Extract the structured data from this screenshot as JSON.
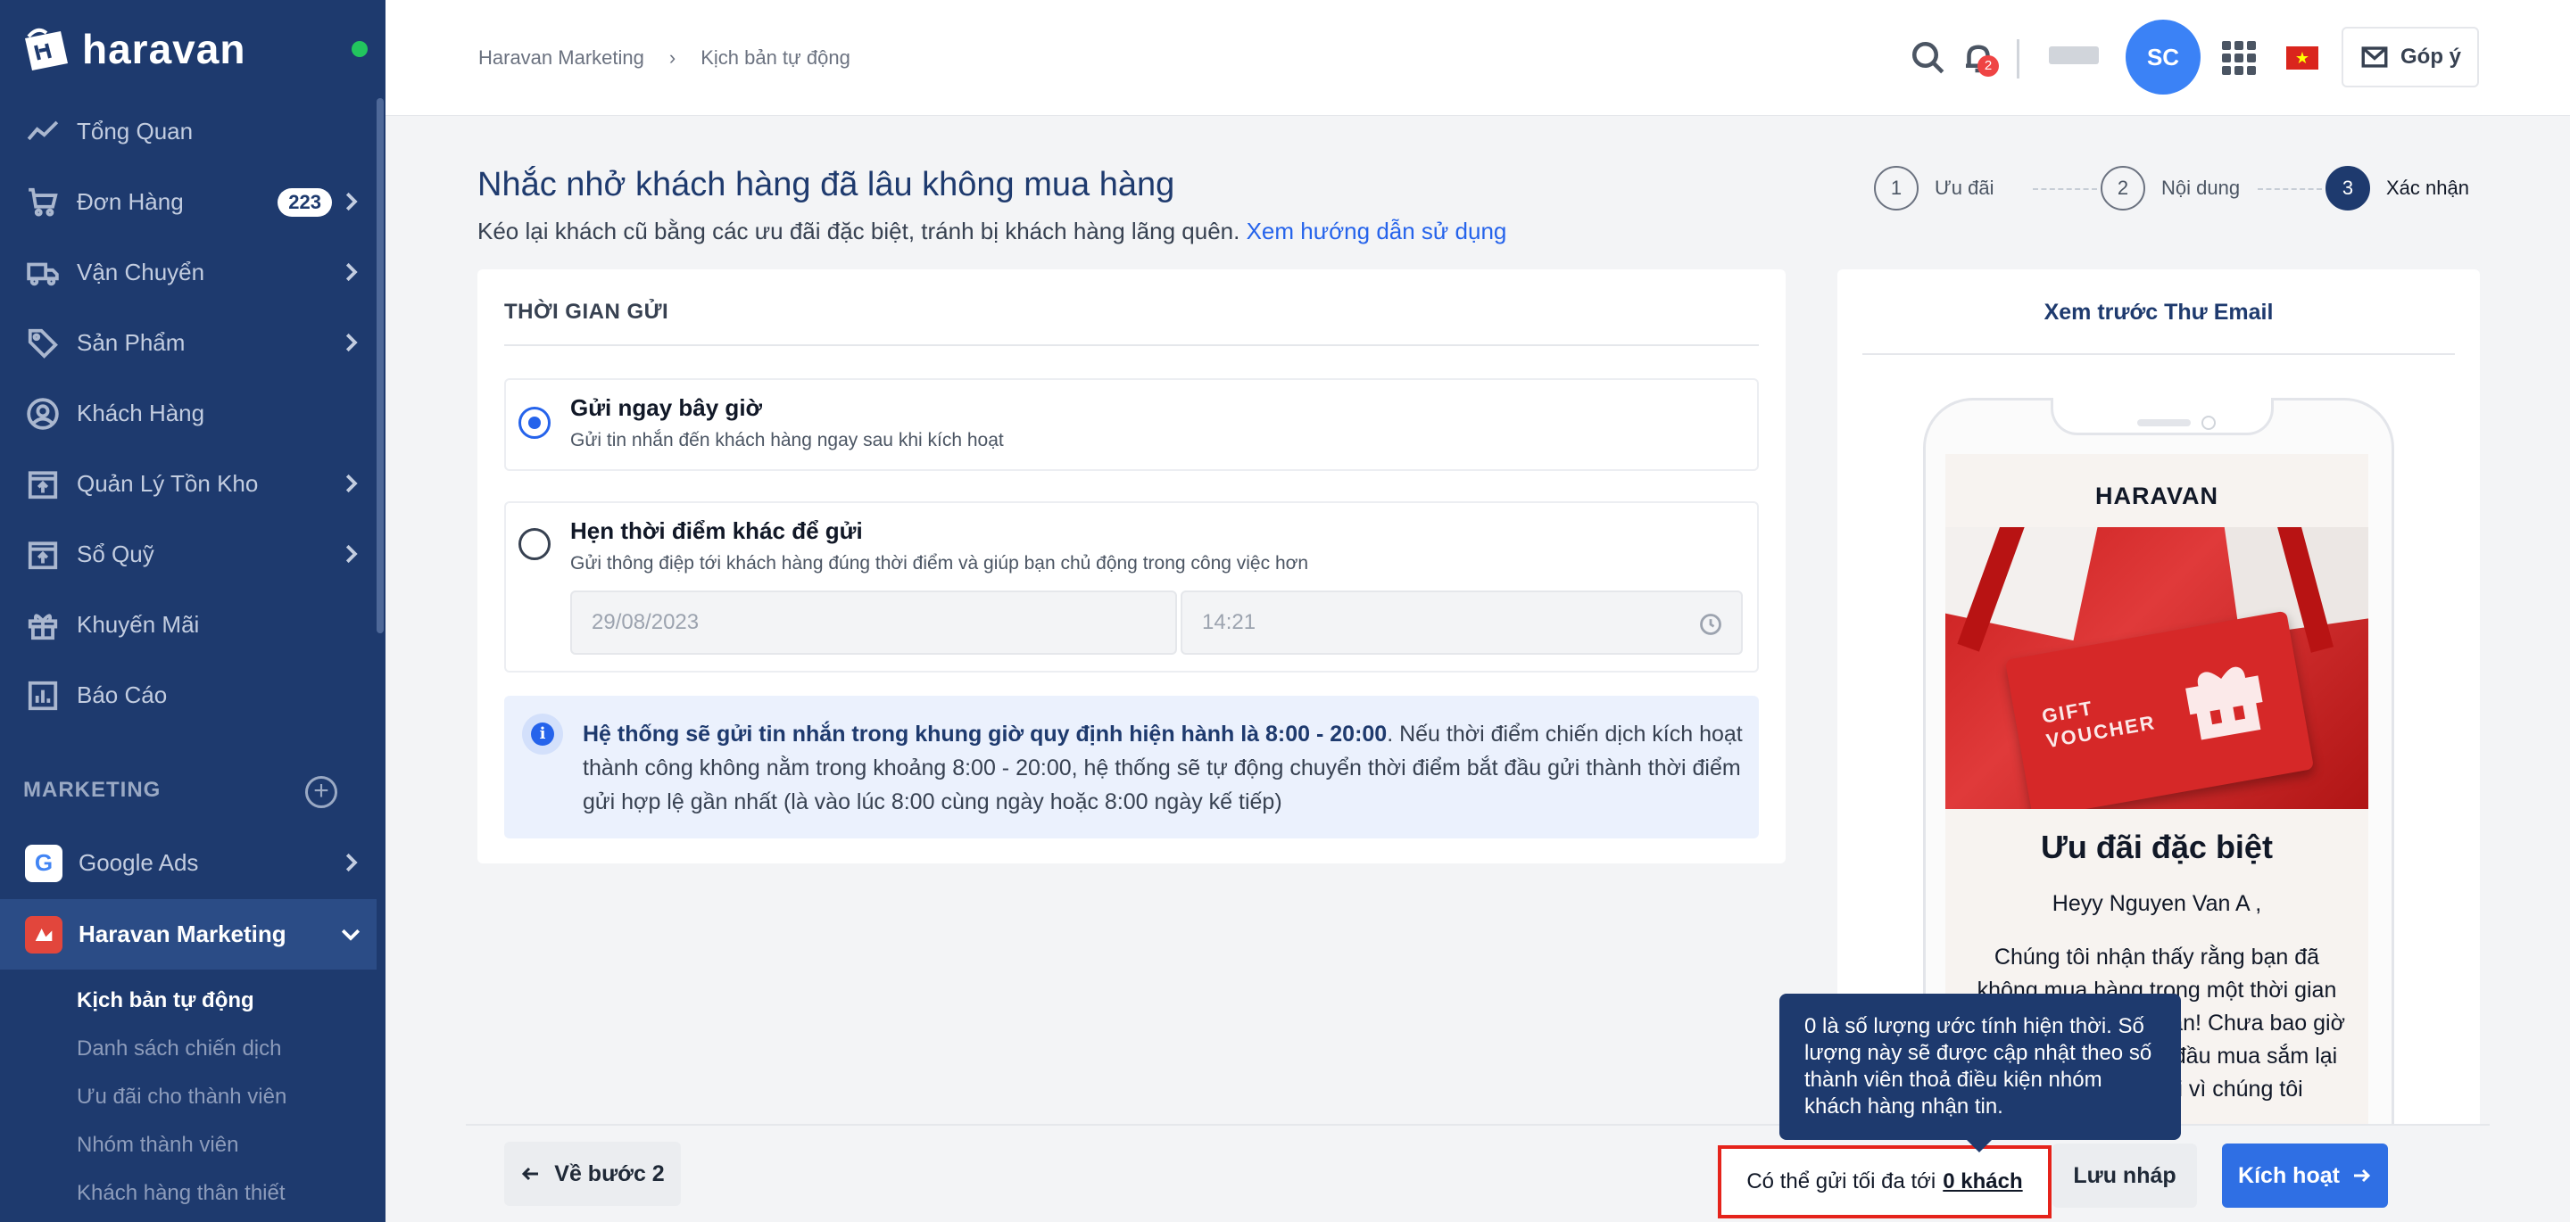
{
  "app": {
    "logo_text": "haravan"
  },
  "sidebar": {
    "items": [
      {
        "label": "Tổng Quan",
        "icon": "trend-icon"
      },
      {
        "label": "Đơn Hàng",
        "icon": "cart-icon",
        "badge": "223"
      },
      {
        "label": "Vận Chuyển",
        "icon": "truck-icon"
      },
      {
        "label": "Sản Phẩm",
        "icon": "tag-icon"
      },
      {
        "label": "Khách Hàng",
        "icon": "user-icon"
      },
      {
        "label": "Quản Lý Tồn Kho",
        "icon": "inventory-icon"
      },
      {
        "label": "Sổ Quỹ",
        "icon": "cashbook-icon"
      },
      {
        "label": "Khuyến Mãi",
        "icon": "gift-icon"
      },
      {
        "label": "Báo Cáo",
        "icon": "report-icon"
      }
    ],
    "section_label": "MARKETING",
    "apps": [
      {
        "label": "Google Ads",
        "icon": "google-icon"
      },
      {
        "label": "Haravan Marketing",
        "icon": "haravan-marketing-icon"
      }
    ],
    "sub_items": [
      "Kịch bản tự động",
      "Danh sách chiến dịch",
      "Ưu đãi cho thành viên",
      "Nhóm thành viên",
      "Khách hàng thân thiết"
    ]
  },
  "topbar": {
    "breadcrumb": [
      "Haravan Marketing",
      "›",
      "Kịch bản tự động"
    ],
    "notification_count": "2",
    "avatar_initials": "SC",
    "feedback_label": "Góp ý",
    "flag_star": "★"
  },
  "page": {
    "title": "Nhắc nhở khách hàng đã lâu không mua hàng",
    "subtitle": "Kéo lại khách cũ bằng các ưu đãi đặc biệt, tránh bị khách hàng lãng quên.",
    "help_link": "Xem hướng dẫn sử dụng",
    "steps": [
      {
        "num": "1",
        "label": "Ưu đãi"
      },
      {
        "num": "2",
        "label": "Nội dung"
      },
      {
        "num": "3",
        "label": "Xác nhận"
      }
    ]
  },
  "send_time": {
    "section_title": "THỜI GIAN GỬI",
    "option_now_title": "Gửi ngay bây giờ",
    "option_now_desc": "Gửi tin nhắn đến khách hàng ngay sau khi kích hoạt",
    "option_schedule_title": "Hẹn thời điểm khác để gửi",
    "option_schedule_desc": "Gửi thông điệp tới khách hàng đúng thời điểm và giúp bạn chủ động trong công việc hơn",
    "date_value": "29/08/2023",
    "time_value": "14:21",
    "info_bold": "Hệ thống sẽ gửi tin nhắn trong khung giờ quy định hiện hành là 8:00 - 20:00",
    "info_rest": ". Nếu thời điểm chiến dịch kích hoạt thành công không nằm trong khoảng 8:00 - 20:00, hệ thống sẽ tự động chuyển thời điểm bắt đầu gửi thành thời điểm gửi hợp lệ gần nhất (là vào lúc 8:00 cùng ngày hoặc 8:00 ngày kế tiếp)",
    "info_icon_char": "i"
  },
  "preview": {
    "title": "Xem trước Thư Email",
    "brand": "HARAVAN",
    "voucher_line1": "GIFT",
    "voucher_line2": "VOUCHER",
    "heading": "Ưu đãi đặc biệt",
    "greeting": "Heyy Nguyen Van A ,",
    "body": "Chúng tôi nhận thấy rằng bạn đã không mua hàng trong một thời gian dài. Chúng tôi nhớ bạn! Chưa bao giờ là quá muộn để bắt đầu mua sắm lại với chúng tôi, bởi vì chúng tôi"
  },
  "footer": {
    "back_label": "Về bước 2",
    "count_prefix": "Có thể gửi tối đa tới",
    "count_value": "0 khách",
    "draft_label": "Lưu nháp",
    "activate_label": "Kích hoạt",
    "tooltip": "0 là số lượng ước tính hiện thời. Số lượng này sẽ được cập nhật theo số thành viên thoả điều kiện nhóm khách hàng nhận tin."
  },
  "colors": {
    "sidebar_bg": "#1e3a6e",
    "primary": "#2f6fe4",
    "highlight_border": "#e5231b"
  }
}
